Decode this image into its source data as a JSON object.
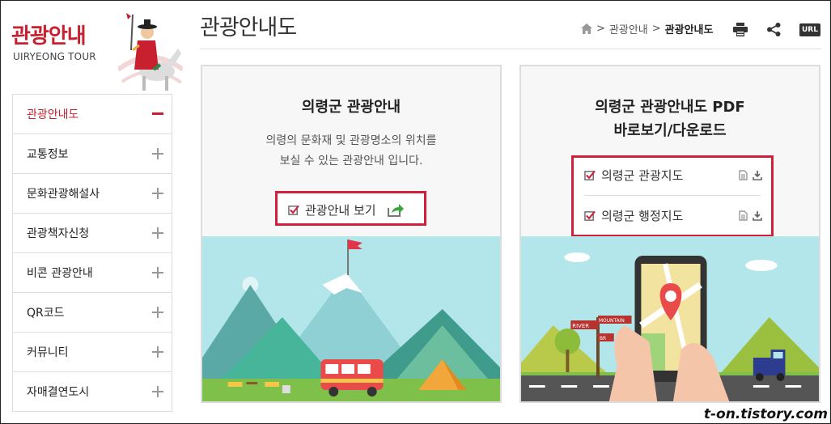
{
  "logo": {
    "title": "관광안내",
    "subtitle": "UIRYEONG TOUR"
  },
  "page": {
    "title": "관광안내도"
  },
  "breadcrumb": {
    "parent": "관광안내",
    "current": "관광안내도",
    "sep": ">"
  },
  "sidebar": {
    "items": [
      {
        "label": "관광안내도",
        "active": true
      },
      {
        "label": "교통정보"
      },
      {
        "label": "문화관광해설사"
      },
      {
        "label": "관광책자신청"
      },
      {
        "label": "비콘 관광안내"
      },
      {
        "label": "QR코드"
      },
      {
        "label": "커뮤니티"
      },
      {
        "label": "자매결연도시"
      }
    ]
  },
  "tools": {
    "print": "print-icon",
    "share": "share-icon",
    "url": "URL"
  },
  "card1": {
    "title": "의령군 관광안내",
    "desc_line1": "의령의 문화재 및 관광명소의 위치를",
    "desc_line2": "보실 수 있는 관광안내 입니다.",
    "link": "관광안내 보기"
  },
  "card2": {
    "title_line1": "의령군 관광안내도 PDF",
    "title_line2": "바로보기/다운로드",
    "links": [
      {
        "label": "의령군 관광지도"
      },
      {
        "label": "의령군 행정지도"
      }
    ]
  },
  "illustration": {
    "sign1": "RIVER",
    "sign2": "MOUNTAIN",
    "sign3": "BR"
  },
  "watermark": "t-on.tistory.com",
  "colors": {
    "accent": "#c8202f",
    "highlight": "#d21f3c",
    "sky": "#b3e6ea",
    "grass": "#7ec049"
  }
}
